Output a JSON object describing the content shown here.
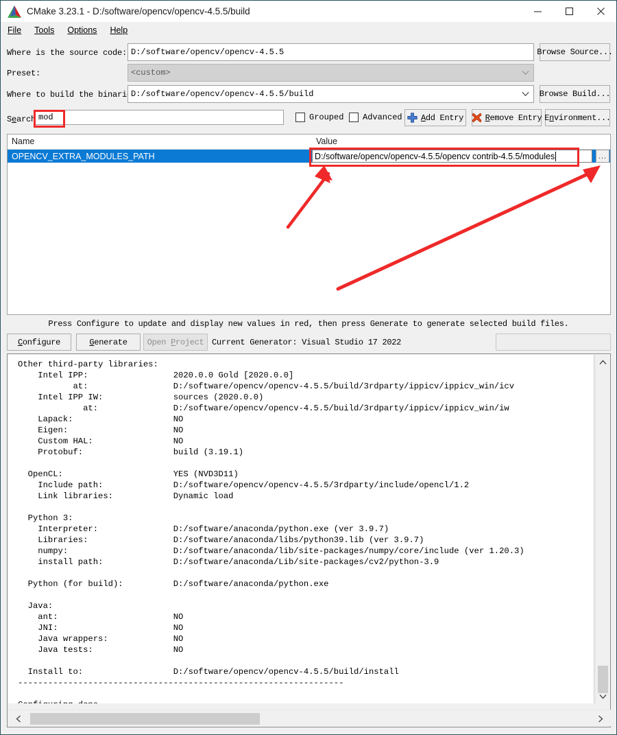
{
  "window": {
    "title": "CMake 3.23.1 - D:/software/opencv/opencv-4.5.5/build",
    "app_icon": "cmake-logo-icon",
    "minimize": "minimize-icon",
    "maximize": "maximize-icon",
    "close": "close-icon"
  },
  "menubar": {
    "items": [
      {
        "label": "File",
        "mnemonic": "F"
      },
      {
        "label": "Tools",
        "mnemonic": "T"
      },
      {
        "label": "Options",
        "mnemonic": "O"
      },
      {
        "label": "Help",
        "mnemonic": "H"
      }
    ]
  },
  "form": {
    "source_label": "Where is the source code:",
    "source_value": "D:/software/opencv/opencv-4.5.5",
    "browse_source_label": "Browse Source...",
    "browse_source_mnemonic": "S",
    "preset_label": "Preset:",
    "preset_value": "<custom>",
    "build_label": "Where to build the binaries:",
    "build_value": "D:/software/opencv/opencv-4.5.5/build",
    "browse_build_label": "Browse Build...",
    "browse_build_mnemonic": "B",
    "search_label": "Search",
    "search_mnemonic": "e",
    "search_value": "mod",
    "grouped_label": "Grouped",
    "grouped_checked": false,
    "advanced_label": "Advanced",
    "advanced_checked": false,
    "add_entry_label": "Add Entry",
    "add_entry_mnemonic": "A",
    "add_entry_icon": "plus-icon",
    "remove_entry_label": "Remove Entry",
    "remove_entry_mnemonic": "R",
    "remove_entry_icon": "red-x-icon",
    "environment_label": "Environment...",
    "environment_mnemonic": "n"
  },
  "cache_table": {
    "columns": [
      "Name",
      "Value"
    ],
    "rows": [
      {
        "name": "OPENCV_EXTRA_MODULES_PATH",
        "value": "D:/software/opencv/opencv-4.5.5/opencv contrib-4.5.5/modules",
        "selected": true,
        "editing": true,
        "browse_button": "..."
      }
    ]
  },
  "actions": {
    "hint": "Press Configure to update and display new values in red, then press Generate to generate selected build files.",
    "configure_label": "Configure",
    "configure_mnemonic": "C",
    "generate_label": "Generate",
    "generate_mnemonic": "G",
    "open_project_label": "Open Project",
    "open_project_mnemonic": "P",
    "open_project_disabled": true,
    "current_generator_label": "Current Generator: Visual Studio 17 2022"
  },
  "log": {
    "text": "Other third-party libraries:\n    Intel IPP:                 2020.0.0 Gold [2020.0.0]\n           at:                 D:/software/opencv/opencv-4.5.5/build/3rdparty/ippicv/ippicv_win/icv\n    Intel IPP IW:              sources (2020.0.0)\n             at:               D:/software/opencv/opencv-4.5.5/build/3rdparty/ippicv/ippicv_win/iw\n    Lapack:                    NO\n    Eigen:                     NO\n    Custom HAL:                NO\n    Protobuf:                  build (3.19.1)\n\n  OpenCL:                      YES (NVD3D11)\n    Include path:              D:/software/opencv/opencv-4.5.5/3rdparty/include/opencl/1.2\n    Link libraries:            Dynamic load\n\n  Python 3:\n    Interpreter:               D:/software/anaconda/python.exe (ver 3.9.7)\n    Libraries:                 D:/software/anaconda/libs/python39.lib (ver 3.9.7)\n    numpy:                     D:/software/anaconda/lib/site-packages/numpy/core/include (ver 1.20.3)\n    install path:              D:/software/anaconda/Lib/site-packages/cv2/python-3.9\n\n  Python (for build):          D:/software/anaconda/python.exe\n\n  Java:\n    ant:                       NO\n    JNI:                       NO\n    Java wrappers:             NO\n    Java tests:                NO\n\n  Install to:                  D:/software/opencv/opencv-4.5.5/build/install\n-----------------------------------------------------------------\n\nConfiguring done",
    "scroll_up_icon": "chevron-up-icon",
    "scroll_down_icon": "chevron-down-icon",
    "scroll_left_icon": "chevron-left-icon",
    "scroll_right_icon": "chevron-right-icon"
  },
  "annotations": {
    "highlight_color": "#ef2929",
    "boxes": [
      {
        "name": "search-field-highlight"
      },
      {
        "name": "value-field-highlight"
      }
    ],
    "arrows": [
      {
        "name": "arrow-to-value-field"
      },
      {
        "name": "arrow-to-browse-dots-button"
      }
    ]
  }
}
